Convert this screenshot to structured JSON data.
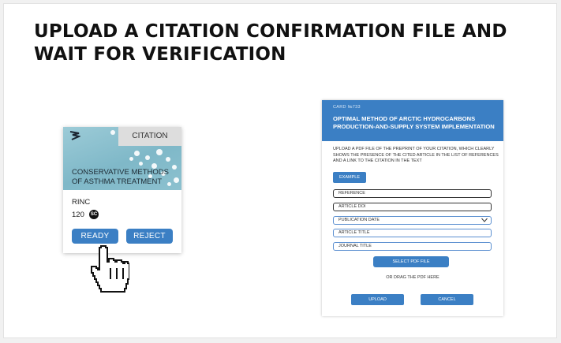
{
  "headline": "UPLOAD A CITATION CONFIRMATION FILE AND WAIT FOR VERIFICATION",
  "citation_card": {
    "tag": "CITATION",
    "title": "CONSERVATIVE METHODS OF ASTHMA TREATMENT",
    "label": "RINC",
    "count": "120",
    "count_icon_text": "SC",
    "ready_label": "READY",
    "reject_label": "REJECT",
    "logo_icon": "logo-icon",
    "pointer_icon": "hand-cursor-icon"
  },
  "form": {
    "card_number": "CARD №733",
    "title": "OPTIMAL METHOD OF ARCTIC HYDROCARBONS PRODUCTION-AND-SUPPLY SYSTEM IMPLEMENTATION",
    "description": "UPLOAD A PDF FILE OF THE PREPRINT OF YOUR CITATION, WHICH CLEARLY SHOWS THE PRESENCE OF THE CITED ARTICLE IN THE LIST OF REFERENCES AND A LINK TO THE CITATION IN THE TEXT",
    "example_label": "EXAMPLE",
    "fields": {
      "reference": "REFERENCE",
      "article_doi": "ARTICLE DOI",
      "publication_date": "PUBLICATION DATE",
      "article_title": "ARTICLE TITLE",
      "journal_title": "JOURNAL TITLE"
    },
    "select_pdf_label": "SELECT PDF FILE",
    "drag_note": "OR DRAG THE PDF HERE",
    "upload_label": "UPLOAD",
    "cancel_label": "CANCEL"
  },
  "colors": {
    "accent": "#3b7fc4",
    "card_image": "#8cc1cf"
  }
}
